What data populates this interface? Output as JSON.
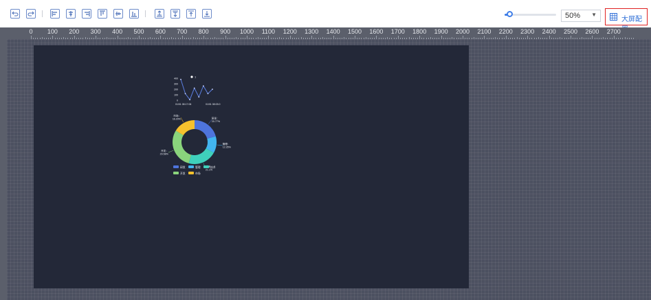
{
  "toolbar": {
    "buttons": [
      "undo-icon",
      "redo-icon",
      "align-left-icon",
      "align-center-icon",
      "align-right-icon",
      "align-top-icon",
      "align-middle-icon",
      "align-bottom-icon",
      "bring-forward-icon",
      "send-backward-icon",
      "bring-to-front-icon",
      "send-to-back-icon"
    ],
    "zoom_slider_value_percent": 50,
    "zoom_value": "50%",
    "config_label": "大屏配置",
    "accent_color": "#3f7ee8",
    "highlight_color": "#e02020"
  },
  "ruler": {
    "labels": [
      "0",
      "100",
      "200",
      "300",
      "400",
      "500",
      "600",
      "700",
      "800",
      "900",
      "1000",
      "1100",
      "1200",
      "1300",
      "1400",
      "1500",
      "1600",
      "1700",
      "1800",
      "1900",
      "2000",
      "2100",
      "2200",
      "2300",
      "2400",
      "2500",
      "2600",
      "2700"
    ]
  },
  "canvas": {
    "background": "#232838",
    "workspace_background": "#4c5060"
  },
  "chart_data": [
    {
      "type": "line",
      "legend": [
        "1"
      ],
      "x_labels": [
        "01/01 08:17:06",
        "01/01 08:03:0"
      ],
      "ylim": [
        0,
        400
      ],
      "y_ticks": [
        "0",
        "100",
        "200",
        "300",
        "400"
      ],
      "series": [
        {
          "name": "1",
          "values": [
            380,
            120,
            10,
            220,
            60,
            260,
            120,
            200
          ]
        }
      ],
      "color": "#5b7ee0"
    },
    {
      "type": "pie",
      "donut": true,
      "slices": [
        {
          "name": "研发",
          "label": "研发：20.77%",
          "value": 20.77,
          "color": "#4e74dc"
        },
        {
          "name": "管理",
          "label": "管理：12.35%",
          "value": 12.35,
          "color": "#42b5f0"
        },
        {
          "name": "技术",
          "label": "技术：21.1%",
          "value": 21.1,
          "color": "#3fd0bb"
        },
        {
          "name": "开发",
          "label": "开发：29.58%",
          "value": 29.58,
          "color": "#8ad47c"
        },
        {
          "name": "市场",
          "label": "市场：16.20%",
          "value": 16.2,
          "color": "#f6c12d"
        }
      ]
    }
  ]
}
